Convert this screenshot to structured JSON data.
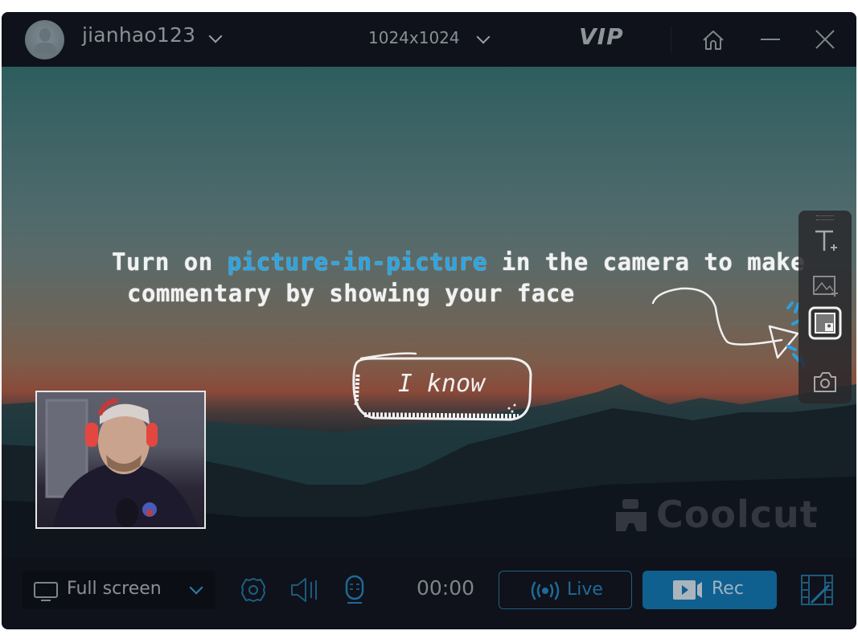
{
  "titlebar": {
    "username": "jianhao123",
    "resolution": "1024x1024",
    "vip_label": "VIP",
    "icons": [
      "avatar",
      "chevron-down-icon",
      "home-icon",
      "minimize-icon",
      "close-icon"
    ]
  },
  "stage": {
    "tip_line1_before": "Turn on ",
    "tip_line1_highlight": "picture-in-picture",
    "tip_line1_after": " in the camera to make",
    "tip_line2": "commentary by showing your face",
    "know_button": "I know",
    "highlight_color": "#2aa6e4",
    "watermark": "Coolcut",
    "side_toolbar": [
      "add-text-icon",
      "add-image-icon",
      "picture-in-picture-icon",
      "camera-icon"
    ]
  },
  "bottombar": {
    "source_label": "Full screen",
    "timer": "00:00",
    "live_label": "Live",
    "rec_label": "Rec",
    "accent_color": "#0f5f8f",
    "icons": [
      "settings-icon",
      "speaker-icon",
      "microphone-icon",
      "video-editor-icon"
    ]
  }
}
